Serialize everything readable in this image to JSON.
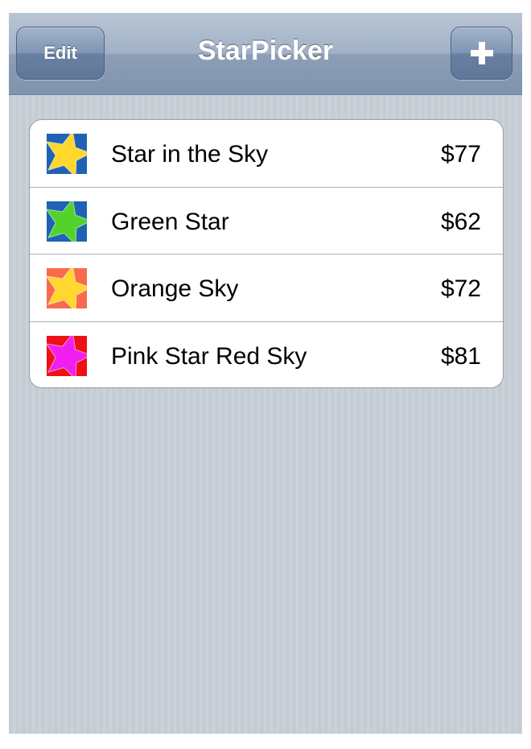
{
  "navbar": {
    "title": "StarPicker",
    "edit_label": "Edit",
    "add_icon": "plus-icon"
  },
  "stars": [
    {
      "name": "Star in the Sky",
      "price": "$77",
      "sky_color": "#1f62b5",
      "star_color": "#ffd72d",
      "icon": "yellow-star-blue-sky"
    },
    {
      "name": "Green Star",
      "price": "$62",
      "sky_color": "#1f62b5",
      "star_color": "#52d32b",
      "icon": "green-star-blue-sky"
    },
    {
      "name": "Orange Sky",
      "price": "$72",
      "sky_color": "#f76b4c",
      "star_color": "#ffd72d",
      "icon": "yellow-star-orange-sky"
    },
    {
      "name": "Pink Star Red Sky",
      "price": "$81",
      "sky_color": "#ee0f17",
      "star_color": "#f01ff0",
      "icon": "pink-star-red-sky"
    }
  ]
}
